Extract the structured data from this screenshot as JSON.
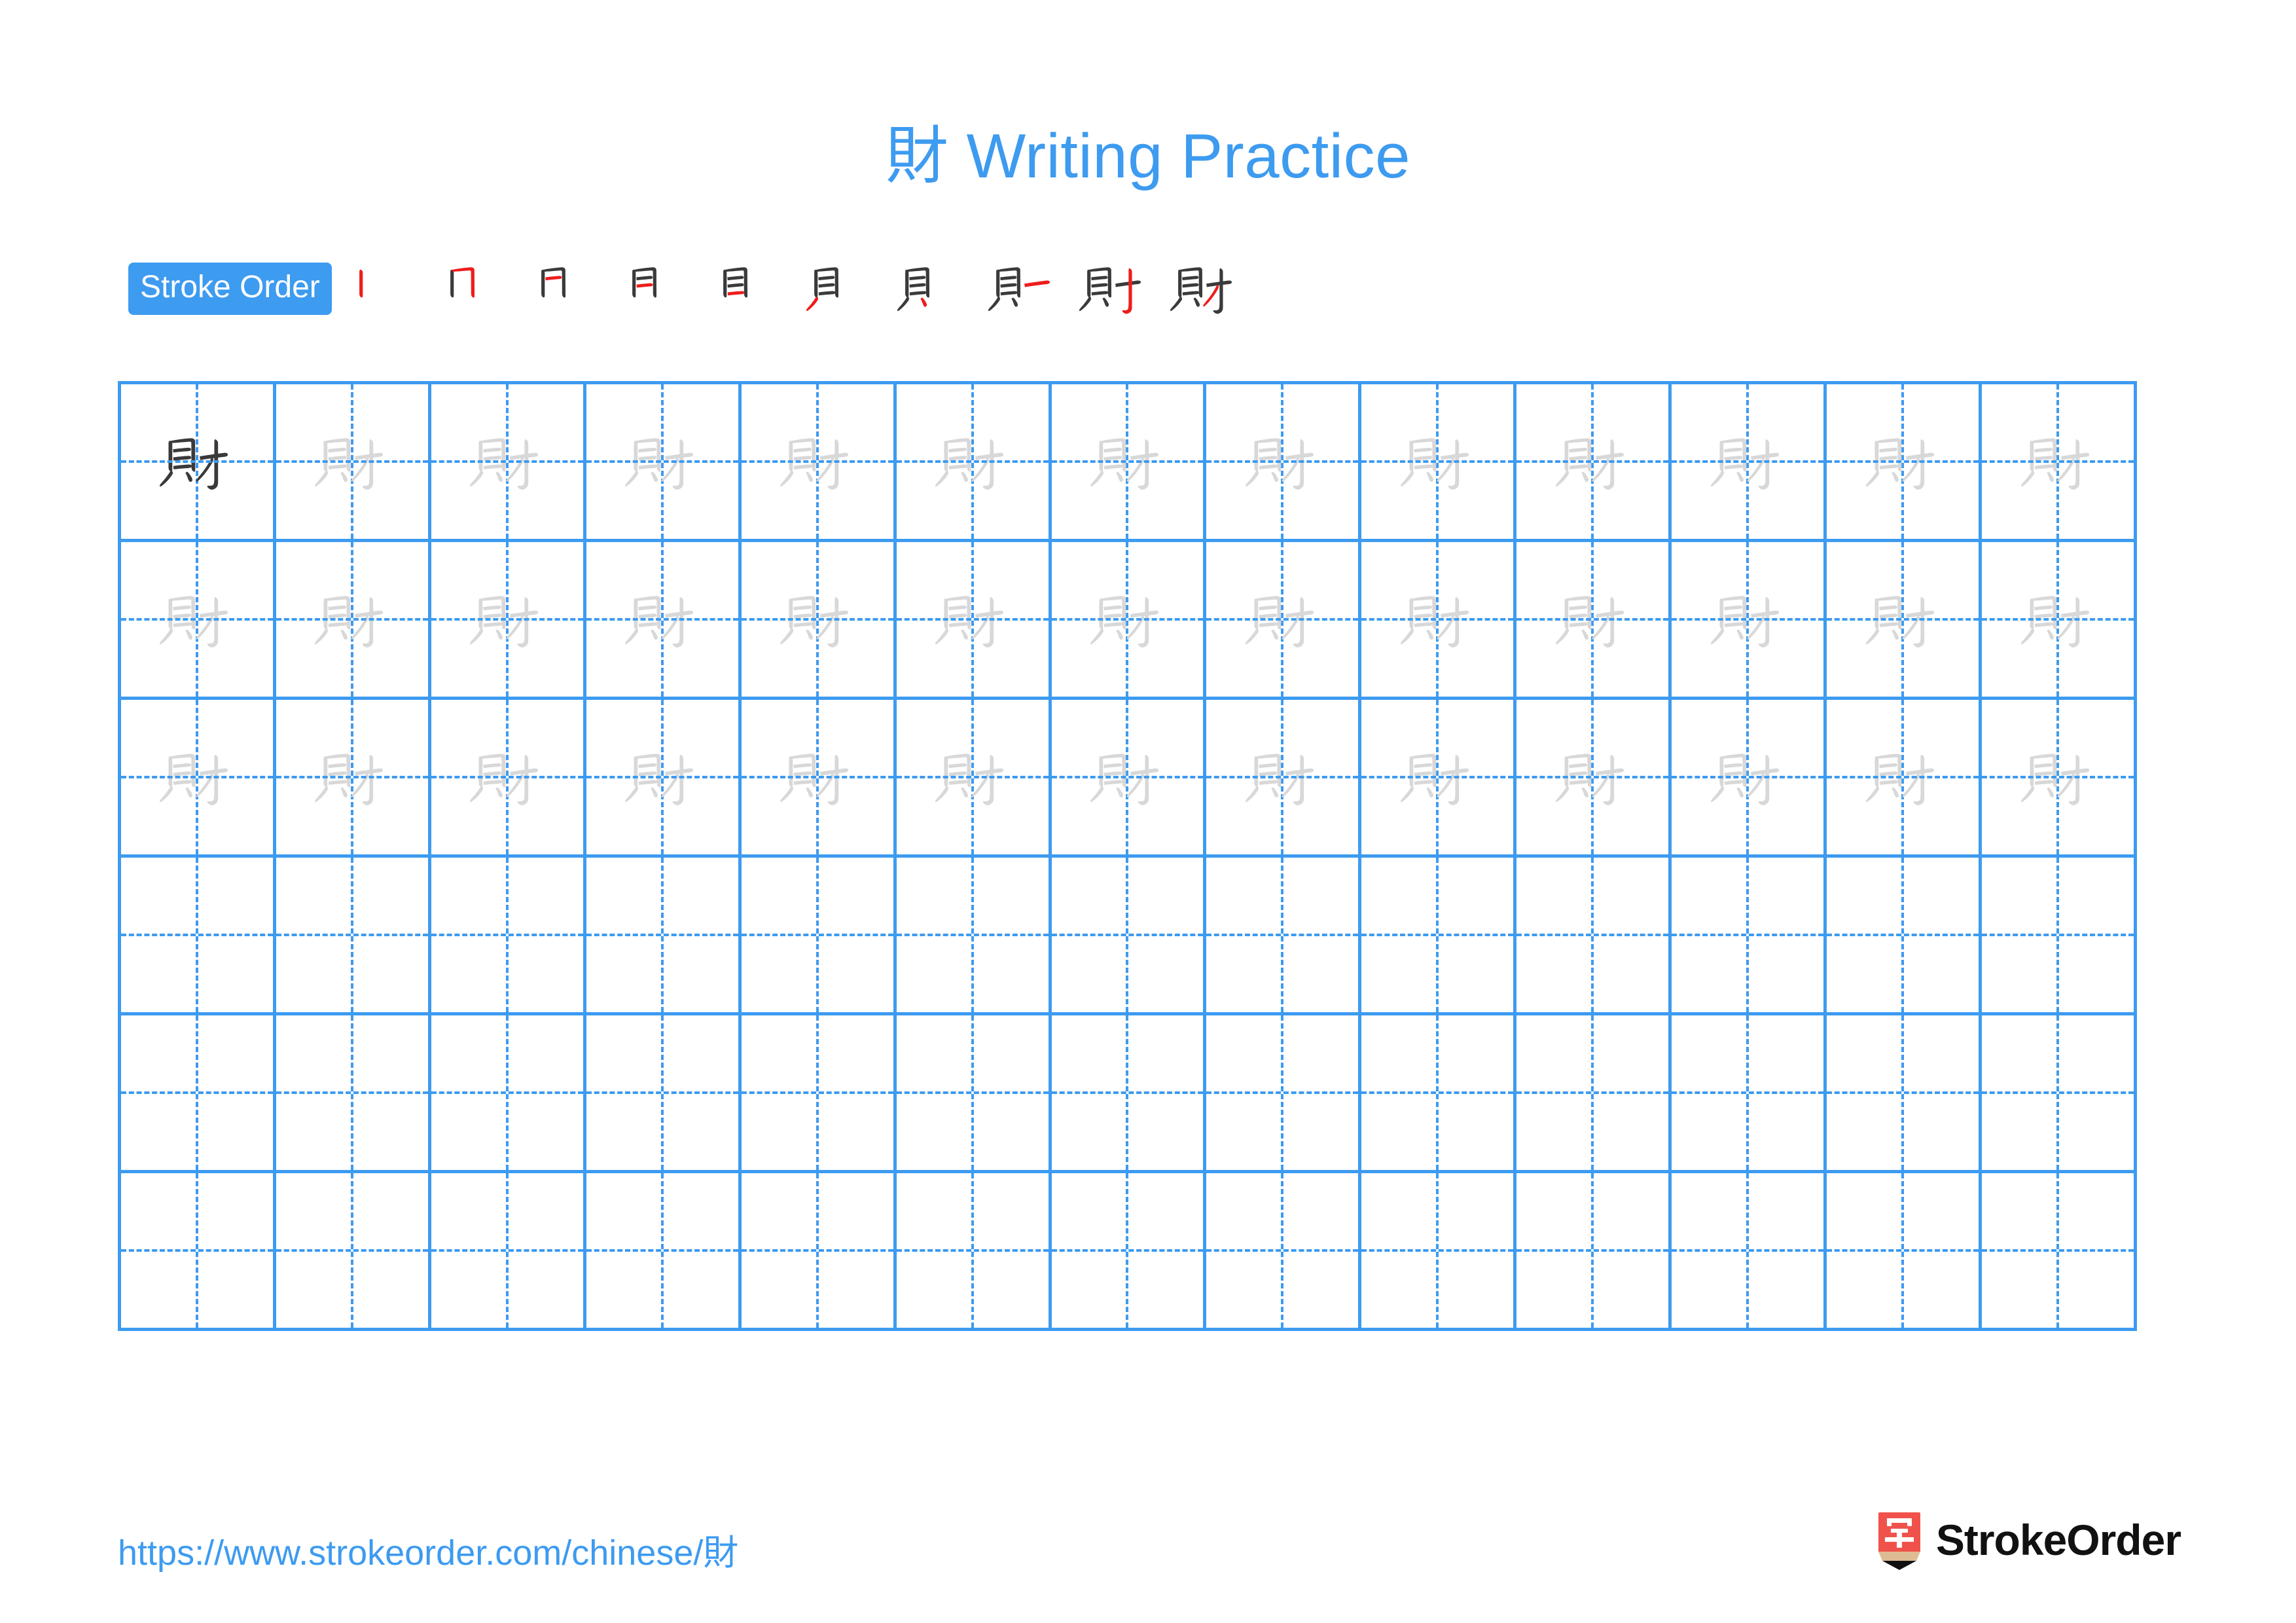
{
  "page": {
    "title": "財 Writing Practice",
    "character": "財",
    "accent_color": "#3D9BF0",
    "model_char_color": "#3A3A3A",
    "trace_char_color": "#D8D8D8",
    "new_stroke_color": "#EE1C1C"
  },
  "stroke_order": {
    "badge_label": "Stroke Order",
    "steps": [
      {
        "index": 1,
        "strokes_shown": 1,
        "label": "stroke-1"
      },
      {
        "index": 2,
        "strokes_shown": 2,
        "label": "stroke-2"
      },
      {
        "index": 3,
        "strokes_shown": 3,
        "label": "stroke-3"
      },
      {
        "index": 4,
        "strokes_shown": 4,
        "label": "stroke-4"
      },
      {
        "index": 5,
        "strokes_shown": 5,
        "label": "stroke-5"
      },
      {
        "index": 6,
        "strokes_shown": 6,
        "label": "stroke-6"
      },
      {
        "index": 7,
        "strokes_shown": 7,
        "label": "stroke-7"
      },
      {
        "index": 8,
        "strokes_shown": 8,
        "label": "stroke-8"
      },
      {
        "index": 9,
        "strokes_shown": 9,
        "label": "stroke-9"
      },
      {
        "index": 10,
        "strokes_shown": 10,
        "label": "stroke-10"
      }
    ],
    "total_strokes": 10
  },
  "grid": {
    "columns": 13,
    "rows": 6,
    "rows_detail": [
      {
        "row": 1,
        "filled": true,
        "first_cell_style": "model"
      },
      {
        "row": 2,
        "filled": true,
        "first_cell_style": "trace"
      },
      {
        "row": 3,
        "filled": true,
        "first_cell_style": "trace"
      },
      {
        "row": 4,
        "filled": false,
        "first_cell_style": "empty"
      },
      {
        "row": 5,
        "filled": false,
        "first_cell_style": "empty"
      },
      {
        "row": 6,
        "filled": false,
        "first_cell_style": "empty"
      }
    ]
  },
  "footer": {
    "url": "https://www.strokeorder.com/chinese/財",
    "brand_name": "StrokeOrder",
    "brand_mark_char": "字"
  }
}
